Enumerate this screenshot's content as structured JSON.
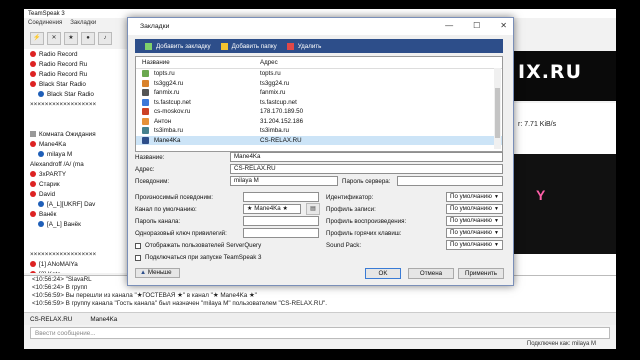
{
  "app": {
    "title": "TeamSpeak 3",
    "menu": [
      "Соединения",
      "Закладки"
    ]
  },
  "tree": [
    {
      "label": "Radio Record",
      "icon": "i-red"
    },
    {
      "label": "Radio Record Ru",
      "icon": "i-red"
    },
    {
      "label": "Radio Record Ru",
      "icon": "i-red"
    },
    {
      "label": "Black Star Radio",
      "icon": "i-red"
    },
    {
      "label": "Black Star Radio",
      "icon": "i-blue"
    },
    {
      "label": "××××××××××××××××××",
      "icon": ""
    },
    {
      "label": "",
      "icon": ""
    },
    {
      "label": "",
      "icon": ""
    },
    {
      "label": "Комната Ожидания",
      "icon": "i-grey"
    },
    {
      "label": "Mane4Ka",
      "icon": "i-red"
    },
    {
      "label": "milaya M",
      "icon": "i-blue"
    },
    {
      "label": "Alexandroff /A/ (ma",
      "icon": ""
    },
    {
      "label": "3xPARTY",
      "icon": "i-red"
    },
    {
      "label": "Старик",
      "icon": "i-red"
    },
    {
      "label": "David",
      "icon": "i-red"
    },
    {
      "label": "[A_L][UKRF] Dav",
      "icon": "i-blue"
    },
    {
      "label": "Ванёк",
      "icon": "i-red"
    },
    {
      "label": "[A_L] Ванёк",
      "icon": "i-blue"
    },
    {
      "label": "",
      "icon": ""
    },
    {
      "label": "",
      "icon": ""
    },
    {
      "label": "××××××××××××××××××",
      "icon": ""
    },
    {
      "label": "[1] ANoMAlYa",
      "icon": "i-red"
    },
    {
      "label": "[2] Kate",
      "icon": "i-red"
    }
  ],
  "banner": {
    "logo": "IX.RU"
  },
  "right_panel": {
    "rate": "r: 7.71 KiB/s"
  },
  "mid_logo": "Y",
  "chat_log": [
    "<10:56:24> \"SlavaRL",
    "<10:56:24> В групп",
    "<10:56:59> Вы перешли из канала \"★ГОСТЕВАЯ ★\" в канал \"★ Mane4Ka ★\"",
    "<10:56:59> В группу канала \"Гость канала\" был назначен \"milaya M\" пользователем \"CS-RELAX.RU\"."
  ],
  "chat_tabs": [
    "CS-RELAX.RU",
    "Mane4Ka"
  ],
  "chat_input_placeholder": "Ввести сообщение...",
  "status_right": "Подключен как: milaya M",
  "dialog": {
    "title": "Закладки",
    "toolbar": {
      "add_bookmark": "Добавить закладку",
      "add_folder": "Добавить папку",
      "delete": "Удалить"
    },
    "columns": {
      "name": "Название",
      "address": "Адрес"
    },
    "bookmarks": [
      {
        "name": "topts.ru",
        "address": "topts.ru"
      },
      {
        "name": "ts3gg24.ru",
        "address": "ts3gg24.ru"
      },
      {
        "name": "fanmix.ru",
        "address": "fanmix.ru"
      },
      {
        "name": "ts.fastcup.net",
        "address": "ts.fastcup.net"
      },
      {
        "name": "cs-moskov.ru",
        "address": "178.170.189.50"
      },
      {
        "name": "Антон",
        "address": "31.204.152.186"
      },
      {
        "name": "ts3imba.ru",
        "address": "ts3imba.ru"
      },
      {
        "name": "Mane4Ka",
        "address": "CS-RELAX.RU"
      }
    ],
    "form": {
      "name_label": "Название:",
      "name_value": "Mane4Ka",
      "address_label": "Адрес:",
      "address_value": "CS-RELAX.RU",
      "nick_label": "Псевдоним:",
      "nick_value": "milaya M",
      "server_pass_label": "Пароль сервера:",
      "phonetic_label": "Произносимый псевдоним:",
      "default_channel_label": "Канал по умолчанию:",
      "default_channel_value": "★ Mane4Ka ★",
      "channel_pass_label": "Пароль канала:",
      "privilege_key_label": "Одноразовый ключ привилегий:",
      "identity_label": "Идентификатор:",
      "capture_label": "Профиль записи:",
      "playback_label": "Профиль воспроизведения:",
      "hotkeys_label": "Профиль горячих клавиш:",
      "soundpack_label": "Sound Pack:",
      "default_option": "По умолчанию",
      "show_serverquery": "Отображать пользователей ServerQuery",
      "connect_on_start": "Подключаться при запуске TeamSpeak 3"
    },
    "buttons": {
      "less": "Меньше",
      "ok": "OK",
      "cancel": "Отмена",
      "apply": "Применить"
    }
  }
}
